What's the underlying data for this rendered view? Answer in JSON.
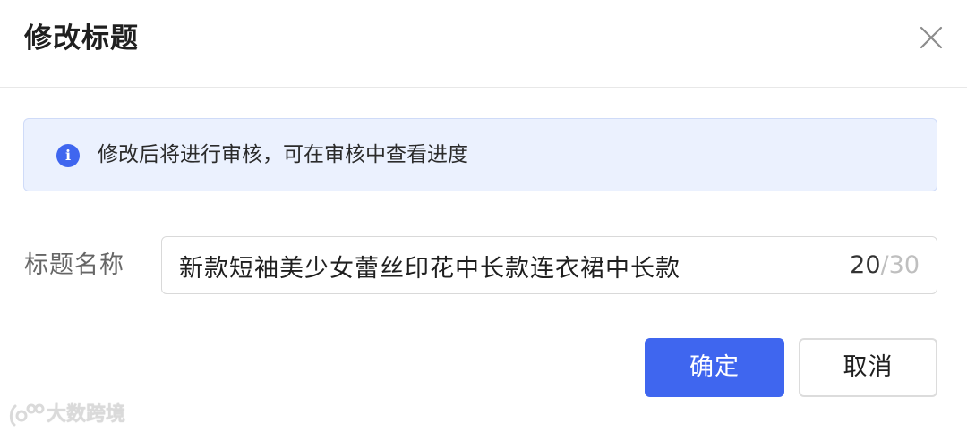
{
  "dialog": {
    "title": "修改标题",
    "close_icon": "close-icon"
  },
  "notice": {
    "icon": "info-icon",
    "icon_glyph": "i",
    "text": "修改后将进行审核，可在审核中查看进度",
    "accent_color": "#3f66ef",
    "background_color": "#ebf1fe"
  },
  "form": {
    "title_field": {
      "label": "标题名称",
      "value": "新款短袖美少女蕾丝印花中长款连衣裙中长款",
      "count_current": "20",
      "count_separator": "/",
      "count_max": "30"
    }
  },
  "actions": {
    "confirm_label": "确定",
    "cancel_label": "取消",
    "primary_color": "#3f66ef"
  },
  "watermark": {
    "text": "大数跨境"
  }
}
